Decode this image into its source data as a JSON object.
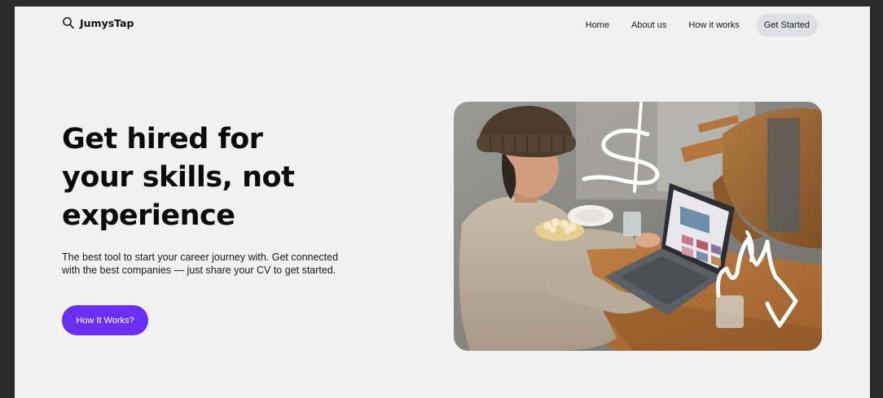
{
  "brand": {
    "name": "JumysTap",
    "icon": "magnifier-logo-icon"
  },
  "nav": {
    "items": [
      {
        "label": "Home"
      },
      {
        "label": "About us"
      },
      {
        "label": "How it works"
      }
    ],
    "cta_label": "Get Started"
  },
  "hero": {
    "title": "Get hired for your skills, not experience",
    "subtitle": "The best tool to start your career journey with. Get connected with the best companies — just share your CV to get started.",
    "button_label": "How It Works?",
    "image": "photo-woman-using-laptop-at-cafe-table"
  },
  "colors": {
    "page_bg": "#f1f1f2",
    "accent": "#6b2ef5",
    "cta_bg": "#dfe0e3",
    "text": "#0b0b0b"
  }
}
